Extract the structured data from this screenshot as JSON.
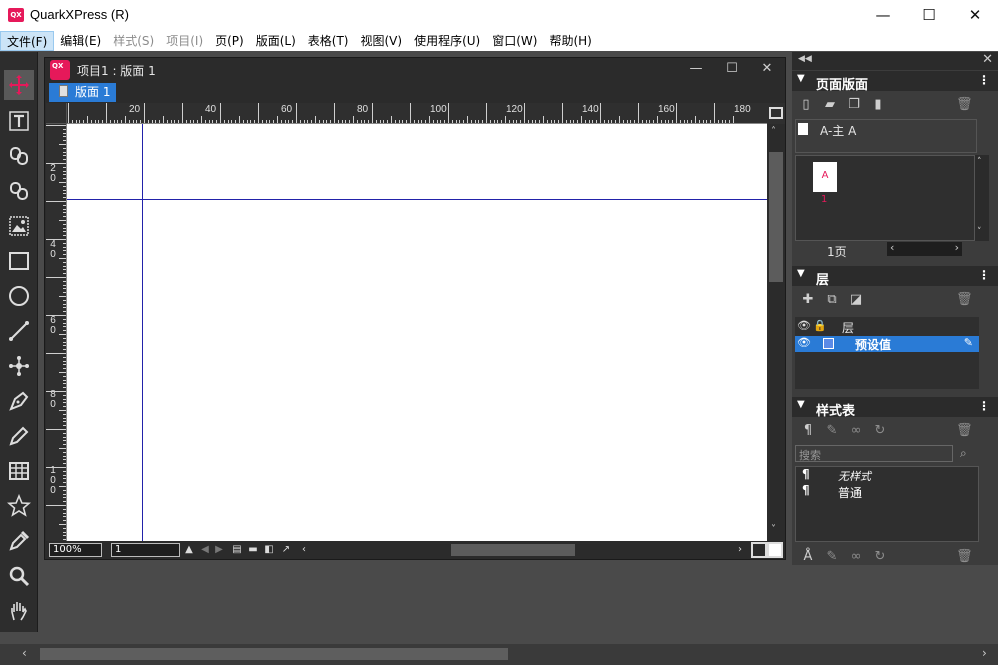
{
  "window": {
    "app_logo": "QX",
    "title": "QuarkXPress (R)",
    "minimize": "—",
    "maximize": "☐",
    "close": "✕"
  },
  "menu": [
    {
      "label": "文件(F)",
      "state": "active"
    },
    {
      "label": "编辑(E)",
      "state": "normal"
    },
    {
      "label": "样式(S)",
      "state": "disabled"
    },
    {
      "label": "项目(I)",
      "state": "disabled"
    },
    {
      "label": "页(P)",
      "state": "normal"
    },
    {
      "label": "版面(L)",
      "state": "normal"
    },
    {
      "label": "表格(T)",
      "state": "normal"
    },
    {
      "label": "视图(V)",
      "state": "normal"
    },
    {
      "label": "使用程序(U)",
      "state": "normal"
    },
    {
      "label": "窗口(W)",
      "state": "normal"
    },
    {
      "label": "帮助(H)",
      "state": "normal"
    }
  ],
  "document": {
    "title": "项目1 : 版面 1",
    "icon_text": "QX",
    "tab_label": "版面 1",
    "zoom": "100%",
    "page_number": "1",
    "hruler_labels": [
      "20",
      "40",
      "60",
      "80",
      "100",
      "120",
      "140",
      "160",
      "180"
    ],
    "vruler_labels": [
      "2\n0",
      "4\n0",
      "6\n0",
      "8\n0",
      "1\n0\n0"
    ]
  },
  "panels": {
    "page_layout": {
      "title": "页面版面",
      "master_label": "A-主 A",
      "thumb_letter": "A",
      "thumb_number": "1",
      "page_count": "1页"
    },
    "layers": {
      "title": "层",
      "header_label": "层",
      "layer_name": "预设值"
    },
    "style_sheets": {
      "title": "样式表",
      "search_placeholder": "搜索",
      "styles": [
        "无样式",
        "普通"
      ]
    }
  },
  "colors": {
    "accent": "#2a7bd6",
    "brand": "#e6195a",
    "guide": "#2222aa"
  }
}
